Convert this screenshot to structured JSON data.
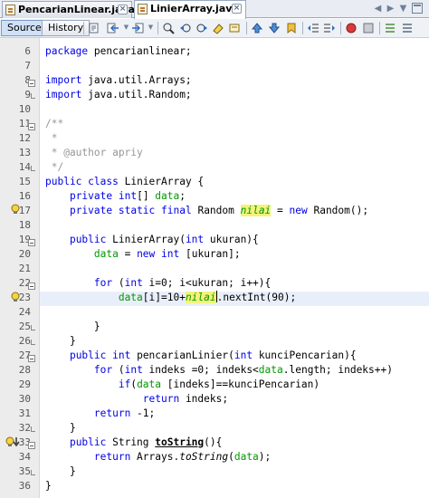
{
  "tabs": [
    {
      "label": "PencarianLinear.java",
      "active": false
    },
    {
      "label": "LinierArray.java",
      "active": true
    }
  ],
  "toolbar": {
    "source_label": "Source",
    "history_label": "History",
    "icons": [
      "last-edit-icon",
      "back-icon",
      "forward-icon",
      "find-icon",
      "find-previous-icon",
      "find-next-icon",
      "toggle-highlight-icon",
      "toggle-rectangular-icon",
      "previous-bookmark-icon",
      "next-bookmark-icon",
      "toggle-bookmark-icon",
      "shift-left-icon",
      "shift-right-icon",
      "start-macro-icon",
      "stop-macro-icon",
      "comment-icon",
      "uncomment-icon"
    ]
  },
  "colors": {
    "keyword": "#0000e6",
    "comment": "#969696",
    "field": "#009900",
    "highlight": "#f5f27a"
  },
  "editor": {
    "lines": [
      {
        "n": "6",
        "text": "package pencarianlinear;"
      },
      {
        "n": "7",
        "text": ""
      },
      {
        "n": "8",
        "text": "import java.util.Arrays;"
      },
      {
        "n": "9",
        "text": "import java.util.Random;"
      },
      {
        "n": "10",
        "text": ""
      },
      {
        "n": "11",
        "text": "/**"
      },
      {
        "n": "12",
        "text": " *"
      },
      {
        "n": "13",
        "text": " * @author apriy"
      },
      {
        "n": "14",
        "text": " */"
      },
      {
        "n": "15",
        "text": "public class LinierArray {"
      },
      {
        "n": "16",
        "text": "    private int[] data;"
      },
      {
        "n": "17",
        "text": "    private static final Random nilai = new Random();"
      },
      {
        "n": "18",
        "text": ""
      },
      {
        "n": "19",
        "text": "    public LinierArray(int ukuran){"
      },
      {
        "n": "20",
        "text": "        data = new int [ukuran];"
      },
      {
        "n": "21",
        "text": ""
      },
      {
        "n": "22",
        "text": "        for (int i=0; i<ukuran; i++){"
      },
      {
        "n": "23",
        "text": "            data[i]=10+nilai.nextInt(90);"
      },
      {
        "n": "24",
        "text": ""
      },
      {
        "n": "25",
        "text": "        }"
      },
      {
        "n": "26",
        "text": "    }"
      },
      {
        "n": "27",
        "text": "    public int pencarianLinier(int kunciPencarian){"
      },
      {
        "n": "28",
        "text": "        for (int indeks =0; indeks<data.length; indeks++)"
      },
      {
        "n": "29",
        "text": "            if(data [indeks]==kunciPencarian)"
      },
      {
        "n": "30",
        "text": "                return indeks;"
      },
      {
        "n": "31",
        "text": "        return -1;"
      },
      {
        "n": "32",
        "text": "    }"
      },
      {
        "n": "33",
        "text": "    public String toString(){"
      },
      {
        "n": "34",
        "text": "        return Arrays.toString(data);"
      },
      {
        "n": "35",
        "text": "    }"
      },
      {
        "n": "36",
        "text": "}"
      }
    ]
  }
}
